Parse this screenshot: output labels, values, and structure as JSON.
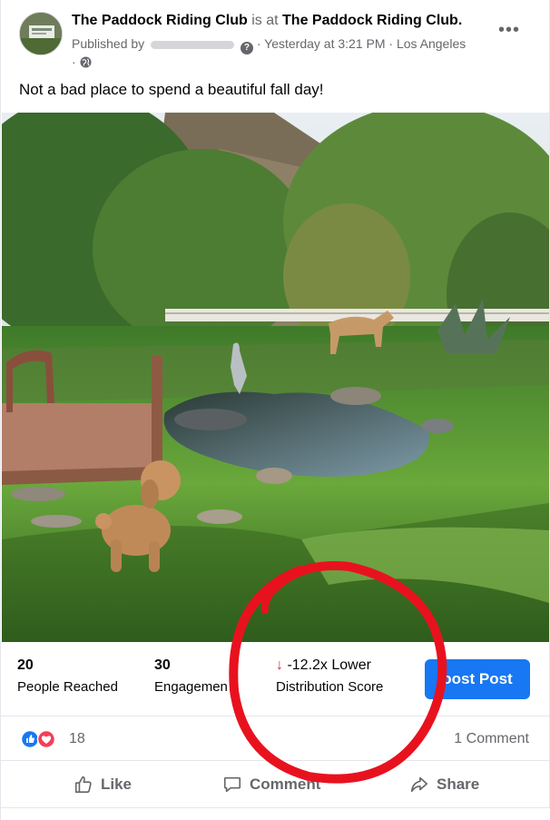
{
  "post": {
    "page_name": "The Paddock Riding Club",
    "is_at": "is at",
    "location_name": "The Paddock Riding Club",
    "published_by": "Published by",
    "timestamp": "Yesterday at 3:21 PM",
    "city": "Los Angeles",
    "text": "Not a bad place to spend a beautiful fall day!"
  },
  "insights": {
    "people_reached_value": "20",
    "people_reached_label": "People Reached",
    "engagements_value": "30",
    "engagements_label": "Engagemen",
    "distribution_value": "-12.2x Lower",
    "distribution_label": "Distribution Score",
    "boost_label": "oost Post"
  },
  "reactions": {
    "count": "18",
    "comments": "1 Comment"
  },
  "actions": {
    "like": "Like",
    "comment": "Comment",
    "share": "Share"
  },
  "colors": {
    "accent": "#1877f2",
    "annotation": "#e8121f",
    "down_arrow": "#e41e3f"
  }
}
